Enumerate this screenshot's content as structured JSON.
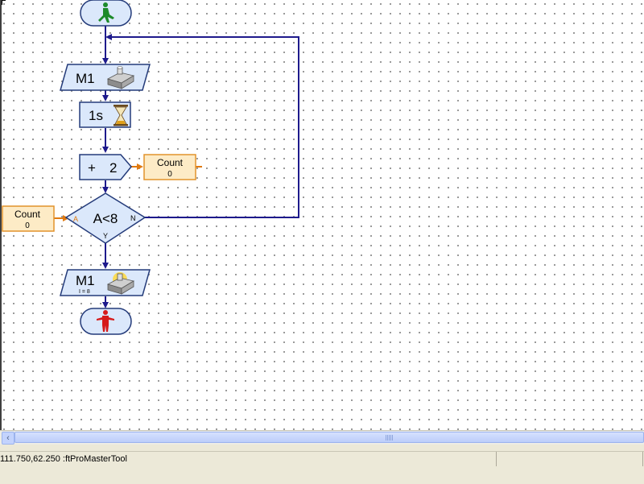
{
  "canvas": {
    "start_block": {
      "icon": "green-walking-man-icon"
    },
    "motor_out_1": {
      "label": "M1",
      "icon": "motor-output-icon"
    },
    "wait_block": {
      "label": "1s",
      "icon": "hourglass-icon"
    },
    "add_block": {
      "op": "+",
      "value": "2"
    },
    "var_count_right": {
      "name": "Count",
      "value": "0"
    },
    "var_count_left": {
      "name": "Count",
      "value": "0"
    },
    "branch": {
      "condition": "A<8",
      "input_label": "A",
      "yes_label": "Y",
      "no_label": "N"
    },
    "motor_out_2": {
      "label": "M1",
      "sub": "I = 8",
      "icon": "lamp-output-icon"
    },
    "stop_block": {
      "icon": "red-standing-man-icon"
    },
    "colors": {
      "block_fill": "#dbe8fb",
      "block_stroke": "#243b7a",
      "connector": "#1e1a8c",
      "var_fill": "#fdebc6",
      "var_stroke": "#e2932c",
      "var_connector": "#e07a10"
    }
  },
  "scrollbar": {
    "left_arrow": "‹",
    "grip": "|||"
  },
  "statusbar": {
    "text": "111.750,62.250 :ftProMasterTool"
  }
}
